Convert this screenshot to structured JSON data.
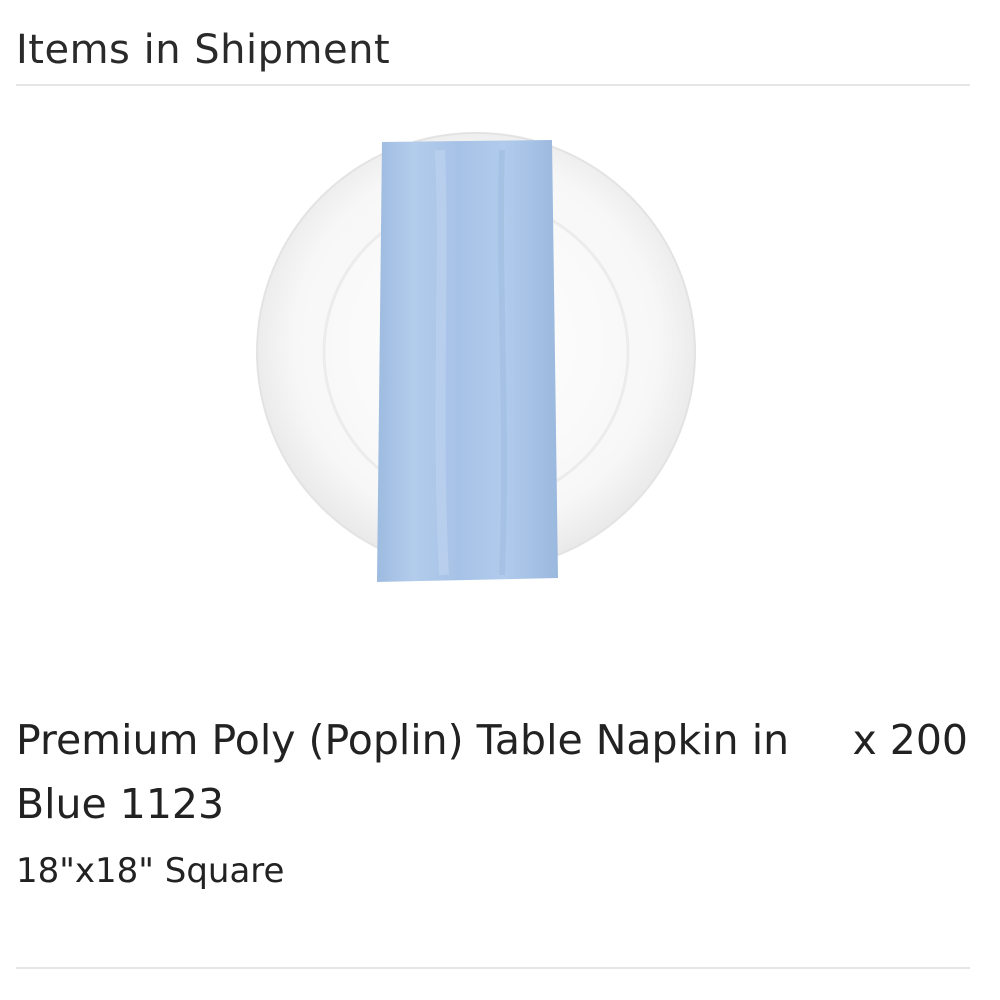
{
  "shipment": {
    "title": "Items in Shipment",
    "items": [
      {
        "name": "Premium Poly (Poplin) Table Napkin in Blue 1123",
        "size": "18\"x18\" Square",
        "quantity": "x 200",
        "image_icon": "napkin-on-plate-image",
        "napkin_color": "#A9C6E8"
      }
    ]
  }
}
